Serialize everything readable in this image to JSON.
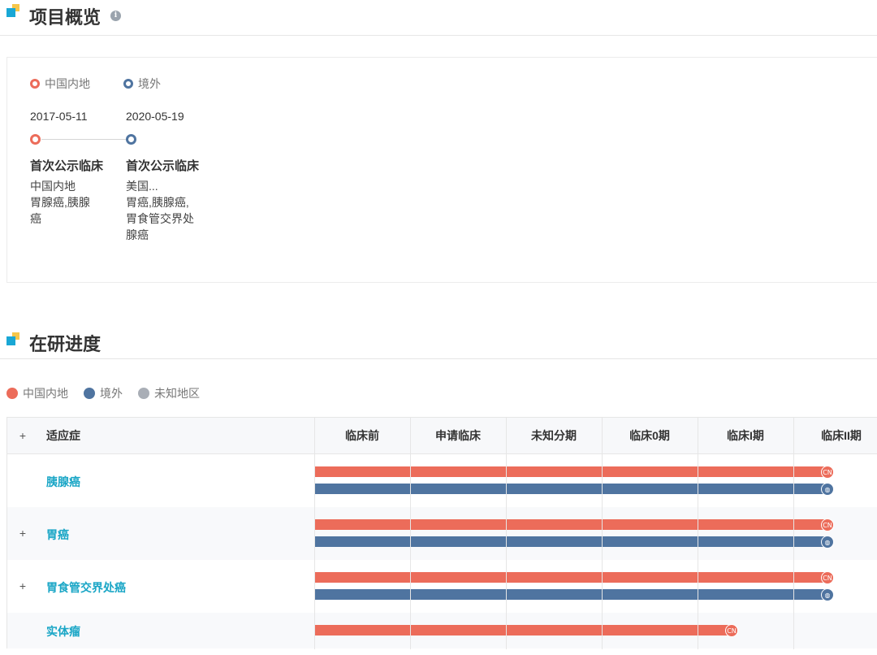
{
  "overview": {
    "title": "项目概览",
    "info_icon": "i",
    "legend": [
      {
        "label": "中国内地",
        "color": "#ec6c5a"
      },
      {
        "label": "境外",
        "color": "#4f74a0"
      }
    ],
    "timeline": [
      {
        "date": "2017-05-11",
        "title": "首次公示临床",
        "region": "中国内地",
        "text": "胃腺癌,胰腺癌",
        "color": "#ec6c5a"
      },
      {
        "date": "2020-05-19",
        "title": "首次公示临床",
        "region": "美国...",
        "text": "胃癌,胰腺癌,胃食管交界处腺癌",
        "color": "#4f74a0"
      }
    ]
  },
  "progress": {
    "title": "在研进度",
    "legend": [
      {
        "label": "中国内地",
        "color": "#ec6c5a"
      },
      {
        "label": "境外",
        "color": "#4f74a0"
      },
      {
        "label": "未知地区",
        "color": "#a9aeb6"
      }
    ],
    "header": {
      "expander": "+",
      "indication_label": "适应症",
      "stages": [
        "临床前",
        "申请临床",
        "未知分期",
        "临床0期",
        "临床I期",
        "临床II期"
      ]
    },
    "cap_labels": {
      "cn": "CN",
      "globe": "◍"
    },
    "rows": [
      {
        "name": "胰腺癌",
        "expandable": false,
        "bars": [
          {
            "region": "cn",
            "stage_reached": 6
          },
          {
            "region": "global",
            "stage_reached": 6
          }
        ]
      },
      {
        "name": "胃癌",
        "expandable": true,
        "bars": [
          {
            "region": "cn",
            "stage_reached": 6
          },
          {
            "region": "global",
            "stage_reached": 6
          }
        ]
      },
      {
        "name": "胃食管交界处癌",
        "expandable": true,
        "bars": [
          {
            "region": "cn",
            "stage_reached": 6
          },
          {
            "region": "global",
            "stage_reached": 6
          }
        ]
      },
      {
        "name": "实体瘤",
        "expandable": false,
        "bars": [
          {
            "region": "cn",
            "stage_reached": 5
          }
        ]
      }
    ]
  }
}
